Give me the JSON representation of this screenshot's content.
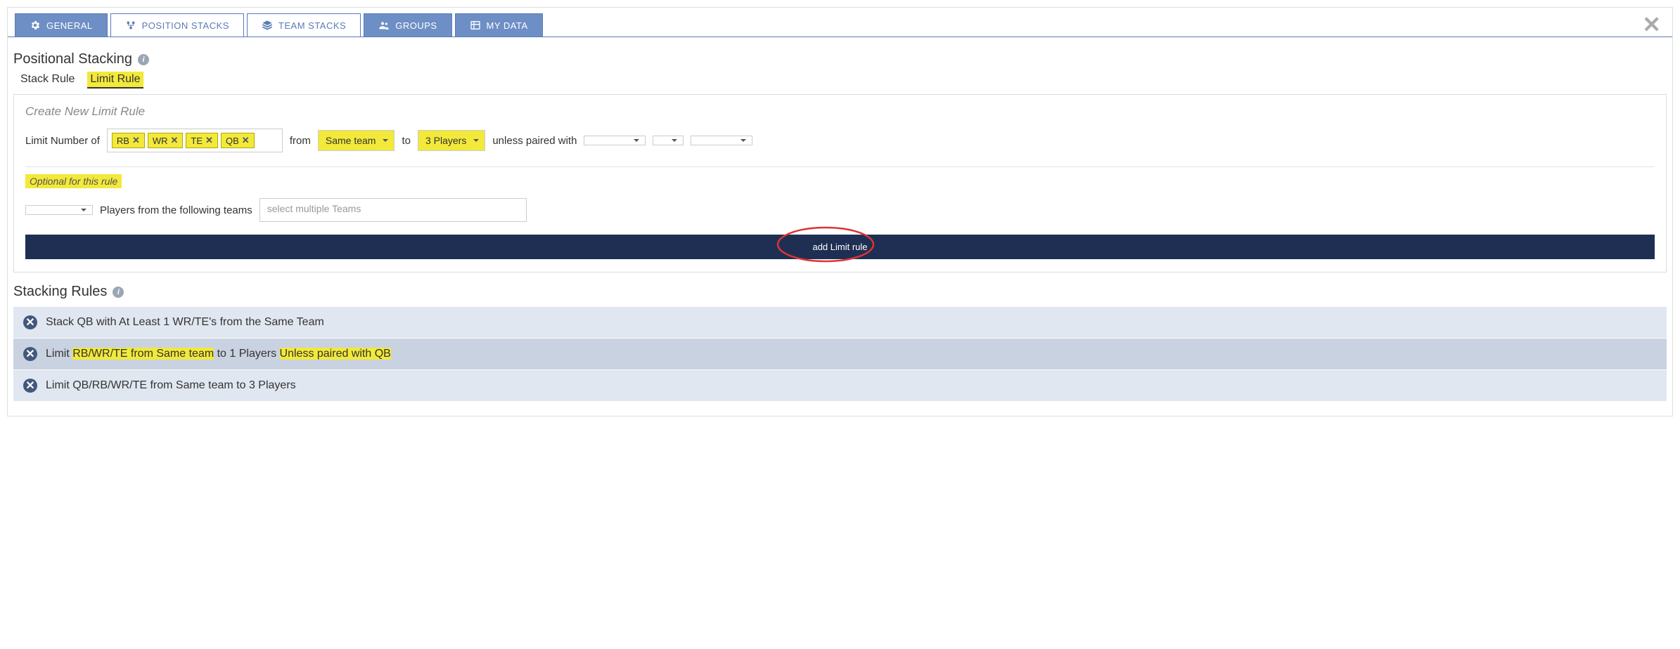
{
  "tabs": {
    "general": "GENERAL",
    "position_stacks": "POSITION STACKS",
    "team_stacks": "TEAM STACKS",
    "groups": "GROUPS",
    "my_data": "MY DATA"
  },
  "section_title": "Positional Stacking",
  "subtabs": {
    "stack_rule": "Stack Rule",
    "limit_rule": "Limit Rule"
  },
  "panel": {
    "title": "Create New Limit Rule",
    "limit_label": "Limit Number of",
    "from_label": "from",
    "to_label": "to",
    "unless_label": "unless paired with",
    "optional_label": "Optional for this rule",
    "teams_label": "Players from the following teams",
    "teams_placeholder": "select multiple Teams",
    "add_btn": "add Limit rule"
  },
  "tags": [
    "RB",
    "WR",
    "TE",
    "QB"
  ],
  "dd_from": "Same team",
  "dd_to": "3 Players",
  "stacking_rules_title": "Stacking Rules",
  "rules": [
    {
      "pre": "Stack QB with At Least 1 WR/TE's from the Same Team",
      "hl1": "",
      "mid": "",
      "hl2": "",
      "post": ""
    },
    {
      "pre": "Limit ",
      "hl1": "RB/WR/TE from Same team",
      "mid": " to 1 Players ",
      "hl2": "Unless paired with QB",
      "post": ""
    },
    {
      "pre": "Limit QB/RB/WR/TE from Same team to 3 Players",
      "hl1": "",
      "mid": "",
      "hl2": "",
      "post": ""
    }
  ]
}
